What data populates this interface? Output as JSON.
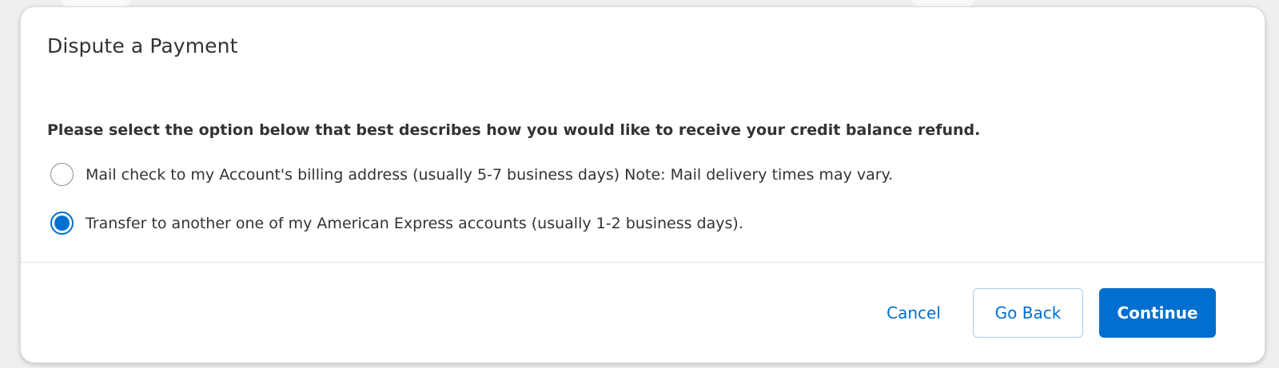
{
  "dialog": {
    "title": "Dispute a Payment",
    "prompt": "Please select the option below that best describes how you would like to receive your credit balance refund.",
    "options": [
      {
        "label": "Mail check to my Account's billing address (usually 5-7 business days) Note: Mail delivery times may vary.",
        "selected": false
      },
      {
        "label": "Transfer to another one of my American Express accounts (usually 1-2 business days).",
        "selected": true
      }
    ],
    "buttons": {
      "cancel": "Cancel",
      "go_back": "Go Back",
      "continue": "Continue"
    }
  },
  "colors": {
    "accent": "#006fcf",
    "text": "#333333",
    "divider": "#dfe0e1"
  }
}
